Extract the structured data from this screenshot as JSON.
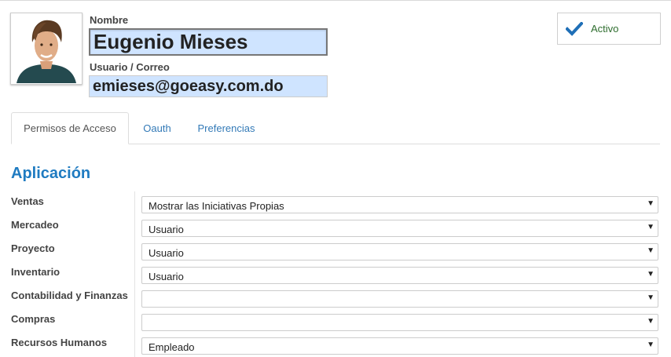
{
  "header": {
    "name_label": "Nombre",
    "name_value": "Eugenio Mieses",
    "login_label": "Usuario / Correo",
    "login_value": "emieses@goeasy.com.do",
    "active_label": "Activo"
  },
  "tabs": [
    {
      "label": "Permisos de Acceso",
      "active": true
    },
    {
      "label": "Oauth",
      "active": false
    },
    {
      "label": "Preferencias",
      "active": false
    }
  ],
  "section": {
    "title": "Aplicación"
  },
  "permissions": [
    {
      "label": "Ventas",
      "value": "Mostrar las Iniciativas Propias"
    },
    {
      "label": "Mercadeo",
      "value": "Usuario"
    },
    {
      "label": "Proyecto",
      "value": "Usuario"
    },
    {
      "label": "Inventario",
      "value": "Usuario"
    },
    {
      "label": "Contabilidad y Finanzas",
      "value": ""
    },
    {
      "label": "Compras",
      "value": ""
    },
    {
      "label": "Recursos Humanos",
      "value": "Empleado"
    }
  ],
  "icons": {
    "avatar": "user-photo",
    "active": "checkmark-icon",
    "dropdown": "caret-down-icon"
  },
  "colors": {
    "accent": "#1f7bc1",
    "link": "#337ab7",
    "check": "#1f6fb7",
    "input_bg": "#cfe4ff"
  }
}
